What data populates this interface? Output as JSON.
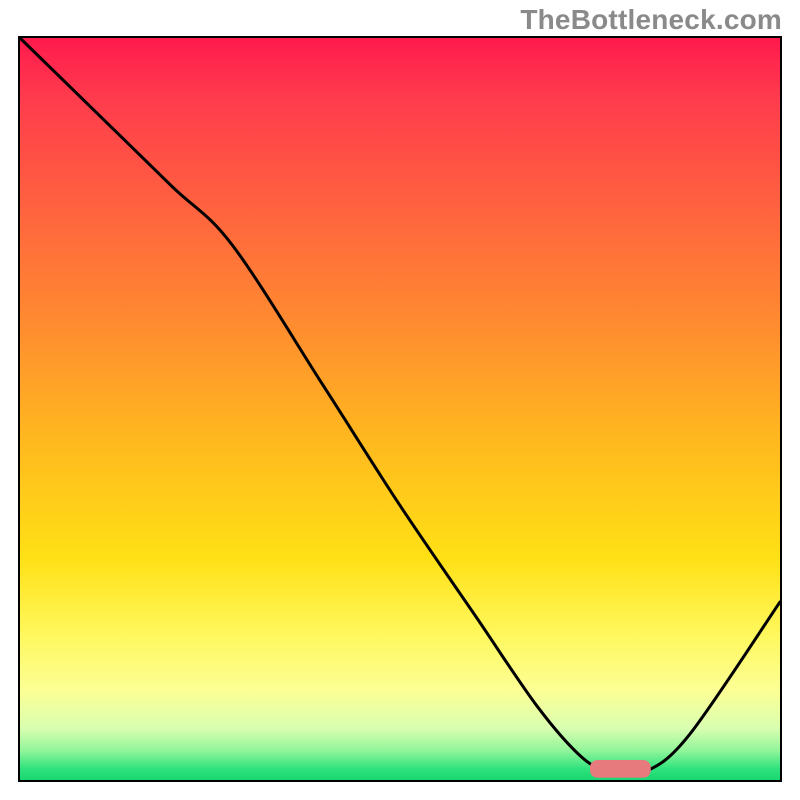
{
  "watermark": "TheBottleneck.com",
  "colors": {
    "frame_border": "#000000",
    "curve_stroke": "#000000",
    "marker_fill": "#e77a7d",
    "gradient_stops": [
      "#ff1a4d",
      "#ff3b4d",
      "#ff6040",
      "#ff8a30",
      "#ffb81f",
      "#ffe015",
      "#fff75a",
      "#fcff95",
      "#d9ffb0",
      "#93f59b",
      "#2fe37d",
      "#18d66f"
    ]
  },
  "chart_data": {
    "type": "line",
    "title": "",
    "xlabel": "",
    "ylabel": "",
    "xlim": [
      0,
      100
    ],
    "ylim": [
      0,
      100
    ],
    "categories_description": "x is normalized 0–100 left→right; y is normalized 0–100 bottom(green)→top(red)",
    "series": [
      {
        "name": "bottleneck-curve",
        "x": [
          0,
          10,
          20,
          28,
          40,
          50,
          60,
          68,
          74,
          78,
          82,
          88,
          100
        ],
        "y": [
          100,
          90,
          80,
          72,
          53,
          37,
          22,
          10,
          3,
          1,
          1,
          6,
          24
        ]
      }
    ],
    "marker": {
      "name": "optimal-zone",
      "x_start": 75,
      "x_end": 83,
      "y": 1.5,
      "shape": "rounded-bar"
    }
  }
}
